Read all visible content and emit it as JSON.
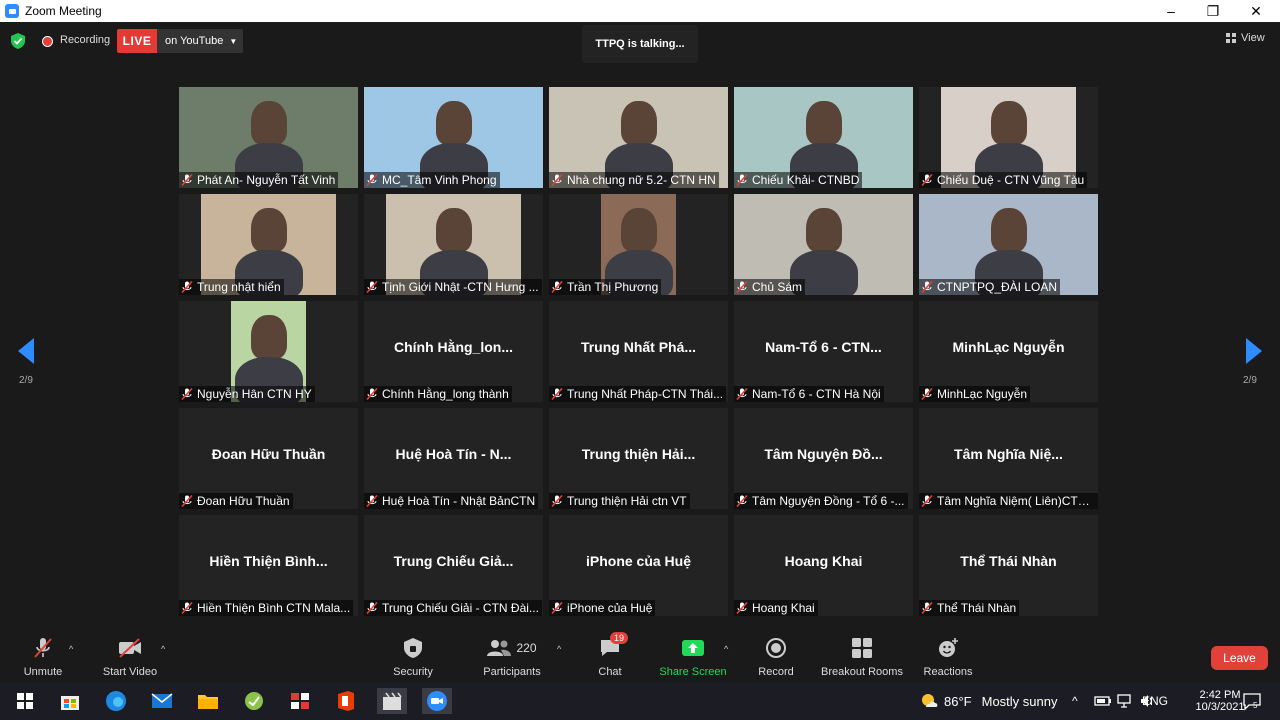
{
  "window": {
    "title": "Zoom Meeting",
    "minimize": "–",
    "maximize": "❐",
    "close": "✕"
  },
  "topbar": {
    "recording_label": "Recording",
    "live_label": "LIVE",
    "live_dest": "on YouTube",
    "talking": "TTPQ is talking...",
    "view_label": "View"
  },
  "pager": {
    "left": "2/9",
    "right": "2/9"
  },
  "participants": [
    {
      "name": "Phát An- Nguyễn Tất Vinh",
      "video": true,
      "bg": "#6e7d6a"
    },
    {
      "name": "MC_Tâm Vinh Phong",
      "video": true,
      "bg": "#9ec7e6"
    },
    {
      "name": "Nhà chung nữ 5.2- CTN HN",
      "video": true,
      "bg": "#c9c3b5"
    },
    {
      "name": "Chiếu Khải- CTNBD",
      "video": true,
      "bg": "#a8c7c4"
    },
    {
      "name": "Chiếu Duệ - CTN Vũng Tàu",
      "video": true,
      "bg": "#d8d0c8"
    },
    {
      "name": "Trung nhật hiển",
      "video": true,
      "bg": "#c8b49a"
    },
    {
      "name": "Tịnh Giới Nhật -CTN Hưng ...",
      "video": true,
      "bg": "#cbbfae"
    },
    {
      "name": "Trần Thị Phương",
      "video": true,
      "bg": "#8b6b58"
    },
    {
      "name": "Chủ Sám",
      "video": true,
      "bg": "#bfbcb3"
    },
    {
      "name": "CTNPTPQ_ĐÀI LOAN",
      "video": true,
      "bg": "#a9b7c8"
    },
    {
      "name": "Nguyễn Hân CTN HY",
      "video": true,
      "bg": "#b9d6a2"
    },
    {
      "name": "Chính Hằng_long thành",
      "display": "Chính Hằng_lon...",
      "video": false
    },
    {
      "name": "Trung Nhất Pháp-CTN Thái...",
      "display": "Trung Nhất Phá...",
      "video": false
    },
    {
      "name": "Nam-Tổ 6 - CTN Hà Nội",
      "display": "Nam-Tổ 6 - CTN...",
      "video": false
    },
    {
      "name": "MinhLạc Nguyễn",
      "display": "MinhLạc Nguyễn",
      "video": false
    },
    {
      "name": "Đoan Hữu Thuần",
      "display": "Đoan Hữu Thuần",
      "video": false
    },
    {
      "name": "Huệ Hoà Tín - Nhật BảnCTN",
      "display": "Huệ Hoà Tín - N...",
      "video": false
    },
    {
      "name": "Trung thiện Hải ctn VT",
      "display": "Trung thiện Hải...",
      "video": false
    },
    {
      "name": "Tâm Nguyện Đồng - Tổ 6 -...",
      "display": "Tâm Nguyện Đồ...",
      "video": false
    },
    {
      "name": "Tâm Nghĩa Niệm( Liên)CTN...",
      "display": "Tâm Nghĩa Niệ...",
      "video": false
    },
    {
      "name": "Hiền Thiện Bình  CTN Mala...",
      "display": "Hiền Thiện Bình...",
      "video": false
    },
    {
      "name": "Trung Chiếu Giải - CTN Đài...",
      "display": "Trung Chiếu Giả...",
      "video": false
    },
    {
      "name": "iPhone của Huệ",
      "display": "iPhone của Huệ",
      "video": false
    },
    {
      "name": "Hoang Khai",
      "display": "Hoang Khai",
      "video": false
    },
    {
      "name": "Thể Thái Nhàn",
      "display": "Thể Thái Nhàn",
      "video": false
    }
  ],
  "toolbar": {
    "unmute": "Unmute",
    "start_video": "Start Video",
    "security": "Security",
    "participants": "Participants",
    "participants_count": "220",
    "chat": "Chat",
    "chat_badge": "19",
    "share_screen": "Share Screen",
    "record": "Record",
    "breakout": "Breakout Rooms",
    "reactions": "Reactions",
    "leave": "Leave"
  },
  "taskbar": {
    "temp": "86°F",
    "weather": "Mostly sunny",
    "lang": "ENG",
    "time": "2:42 PM",
    "date": "10/3/2021",
    "notif_count": "5"
  },
  "colors": {
    "accent": "#2d8cff",
    "live": "#e53935",
    "leave": "#e0413b",
    "share": "#23d959"
  }
}
